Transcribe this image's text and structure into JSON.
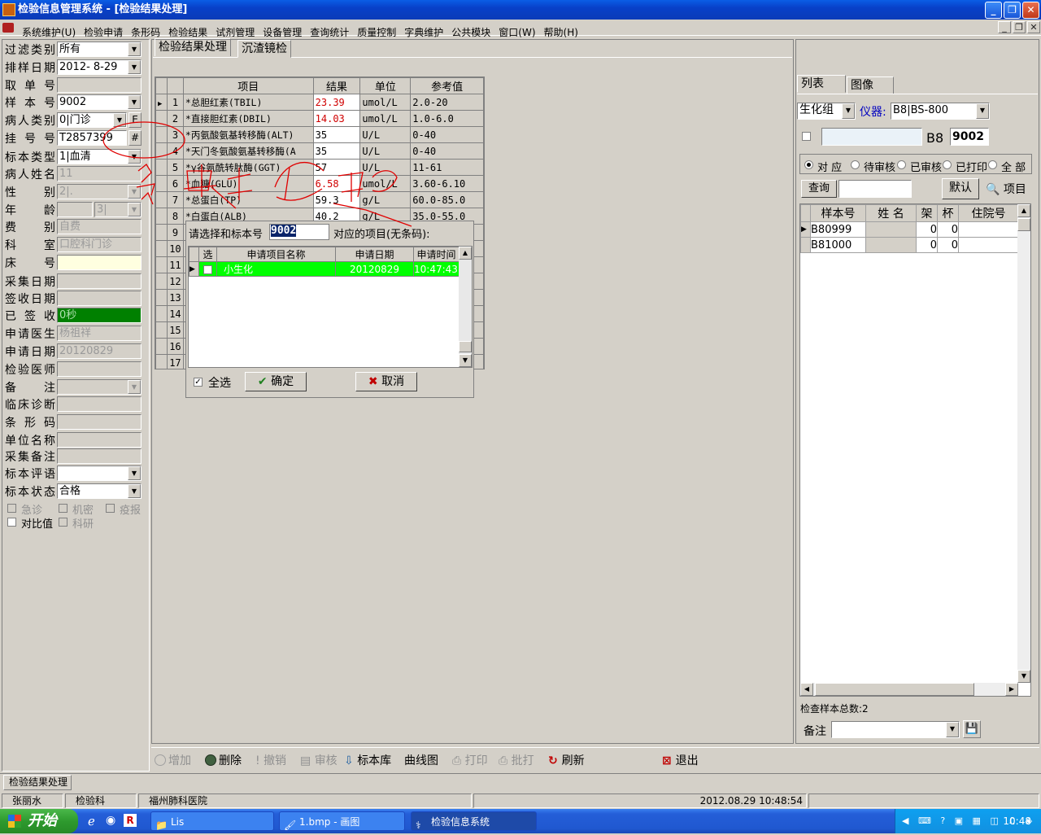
{
  "window": {
    "title": "检验信息管理系统 - [检验结果处理]",
    "min": "_",
    "max": "❐",
    "close": "✕"
  },
  "menu": [
    "系统维护(U)",
    "检验申请",
    "条形码",
    "检验结果",
    "试剂管理",
    "设备管理",
    "查询统计",
    "质量控制",
    "字典维护",
    "公共模块",
    "窗口(W)",
    "帮助(H)"
  ],
  "left_form": {
    "filter_type": {
      "label": "过滤类别",
      "value": "所有"
    },
    "sort_date": {
      "label": "排样日期",
      "value": "2012- 8-29"
    },
    "take_no": {
      "label": "取单号",
      "value": ""
    },
    "sample_no": {
      "label": "样本号",
      "value": "9002"
    },
    "patient_type": {
      "label": "病人类别",
      "value": "0|门诊",
      "btn": "E"
    },
    "reg_no": {
      "label": "挂号号",
      "value": "T2857399",
      "btn": "#"
    },
    "specimen_type": {
      "label": "标本类型",
      "value": "1|血清"
    },
    "patient_name": {
      "label": "病人姓名",
      "value": "11"
    },
    "gender": {
      "label": "性别",
      "value": "2|."
    },
    "age": {
      "label": "年龄",
      "value": "",
      "unit": "3|"
    },
    "fee_type": {
      "label": "费别",
      "value": "自费"
    },
    "department": {
      "label": "科室",
      "value": "口腔科门诊"
    },
    "bed_no": {
      "label": "床号",
      "value": ""
    },
    "collect_date": {
      "label": "采集日期",
      "value": ""
    },
    "receive_date": {
      "label": "签收日期",
      "value": ""
    },
    "received": {
      "label": "已签收",
      "value": "0秒"
    },
    "req_doctor": {
      "label": "申请医生",
      "value": "杨祖祥"
    },
    "req_date": {
      "label": "申请日期",
      "value": "20120829"
    },
    "test_doctor": {
      "label": "检验医师",
      "value": ""
    },
    "remark": {
      "label": "备注",
      "value": ""
    },
    "diagnosis": {
      "label": "临床诊断",
      "value": ""
    },
    "barcode": {
      "label": "条形码",
      "value": ""
    },
    "unit_name": {
      "label": "单位名称",
      "value": ""
    },
    "collect_remark": {
      "label": "采集备注",
      "value": ""
    },
    "specimen_comment": {
      "label": "标本评语",
      "value": ""
    },
    "specimen_status": {
      "label": "标本状态",
      "value": "合格"
    },
    "checks": {
      "urgent": "急诊",
      "secret": "机密",
      "epidemic": "疫报",
      "compare": "对比值",
      "research": "科研"
    }
  },
  "tabs": {
    "results": "检验结果处理",
    "sediment": "沉渣镜检"
  },
  "grid": {
    "headers": {
      "item": "项目",
      "result": "结果",
      "unit": "单位",
      "ref": "参考值"
    },
    "rows": [
      {
        "n": "1",
        "item": "*总胆红素(TBIL)",
        "result": "23.39",
        "unit": "umol/L",
        "ref": "2.0-20",
        "abnormal": true
      },
      {
        "n": "2",
        "item": "*直接胆红素(DBIL)",
        "result": "14.03",
        "unit": "umol/L",
        "ref": "1.0-6.0",
        "abnormal": true
      },
      {
        "n": "3",
        "item": "*丙氨酸氨基转移酶(ALT)",
        "result": "35",
        "unit": "U/L",
        "ref": "0-40",
        "abnormal": false
      },
      {
        "n": "4",
        "item": "*天门冬氨酸氨基转移酶(A",
        "result": "35",
        "unit": "U/L",
        "ref": "0-40",
        "abnormal": false
      },
      {
        "n": "5",
        "item": "*γ谷氨酰转肽酶(GGT)",
        "result": "57",
        "unit": "U/L",
        "ref": "11-61",
        "abnormal": false
      },
      {
        "n": "6",
        "item": "*血糖(GLU)",
        "result": "6.58",
        "unit": "umol/L",
        "ref": "3.60-6.10",
        "abnormal": true
      },
      {
        "n": "7",
        "item": "*总蛋白(TP)",
        "result": "59.3",
        "unit": "g/L",
        "ref": "60.0-85.0",
        "abnormal": false
      },
      {
        "n": "8",
        "item": "*白蛋白(ALB)",
        "result": "40.2",
        "unit": "g/L",
        "ref": "35.0-55.0",
        "abnormal": false
      }
    ],
    "empty_rows": [
      "9",
      "10",
      "11",
      "12",
      "13",
      "14",
      "15",
      "16",
      "17"
    ]
  },
  "popup": {
    "prompt": "请选择和标本号",
    "sample_no": "9002",
    "suffix": "对应的项目(无条码):",
    "headers": {
      "sel": "选",
      "name": "申请项目名称",
      "date": "申请日期",
      "time": "申请时间"
    },
    "row": {
      "name": "小生化",
      "date": "20120829",
      "time": "10:47:43"
    },
    "select_all": "全选",
    "ok": "确定",
    "cancel": "取消"
  },
  "right": {
    "tab_list": "列表",
    "tab_image": "图像",
    "group": "生化组",
    "instrument_label": "仪器:",
    "instrument": "B8|BS-800",
    "prefix": "B8",
    "sample_no": "9002",
    "filters": {
      "match": "对 应",
      "pending": "待审核",
      "reviewed": "已审核",
      "printed": "已打印",
      "all": "全 部"
    },
    "query_btn": "查询",
    "default_btn": "默认",
    "item_btn": "项目",
    "table_headers": {
      "sample": "样本号",
      "name": "姓 名",
      "rack": "架",
      "cup": "杯",
      "inpatient": "住院号"
    },
    "table_rows": [
      {
        "sample": "B80999",
        "name": "",
        "rack": "0",
        "cup": "0",
        "inpatient": ""
      },
      {
        "sample": "B81000",
        "name": "",
        "rack": "0",
        "cup": "0",
        "inpatient": ""
      }
    ],
    "total": "检查样本总数:2",
    "remark_label": "备注"
  },
  "toolbar": {
    "add": "增加",
    "delete": "删除",
    "undo": "撤销",
    "review": "审核",
    "library": "标本库",
    "curve": "曲线图",
    "print": "打印",
    "batch": "批打",
    "refresh": "刷新",
    "exit": "退出"
  },
  "mdi_tab": "检验结果处理",
  "status": {
    "user": "张丽水",
    "dept": "检验科",
    "hospital": "福州肺科医院",
    "datetime": "2012.08.29 10:48:54"
  },
  "taskbar": {
    "start": "开始",
    "task1": "Lis",
    "task2": "1.bmp - 画图",
    "task3": "检验信息系统",
    "time": "10:48"
  }
}
